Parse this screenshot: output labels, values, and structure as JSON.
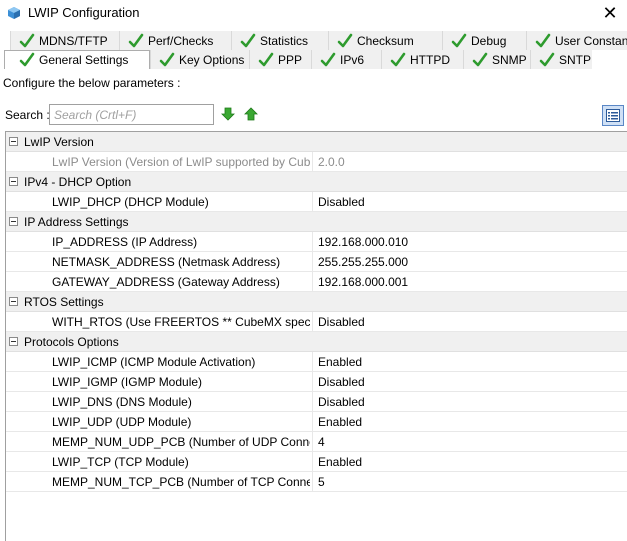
{
  "window": {
    "title": "LWIP Configuration",
    "close_glyph": "✕"
  },
  "tabs": {
    "back_row": [
      {
        "label": "MDNS/TFTP"
      },
      {
        "label": "Perf/Checks"
      },
      {
        "label": "Statistics"
      },
      {
        "label": "Checksum"
      },
      {
        "label": "Debug"
      },
      {
        "label": "User Constants"
      }
    ],
    "front_row": [
      {
        "label": "General Settings",
        "active": true
      },
      {
        "label": "Key Options"
      },
      {
        "label": "PPP"
      },
      {
        "label": "IPv6"
      },
      {
        "label": "HTTPD"
      },
      {
        "label": "SNMP"
      },
      {
        "label": "SNTP"
      }
    ]
  },
  "configure_text": "Configure the below parameters :",
  "search": {
    "label": "Search :",
    "placeholder": "Search (Crtl+F)",
    "value": ""
  },
  "groups": [
    {
      "label": "LwIP Version",
      "params": [
        {
          "name": "LwIP Version (Version of LwIP supported by CubeMX)",
          "value": "2.0.0",
          "disabled": true
        }
      ]
    },
    {
      "label": "IPv4 - DHCP Option",
      "params": [
        {
          "name": "LWIP_DHCP (DHCP Module)",
          "value": "Disabled"
        }
      ]
    },
    {
      "label": "IP Address Settings",
      "params": [
        {
          "name": "IP_ADDRESS (IP Address)",
          "value": "192.168.000.010"
        },
        {
          "name": "NETMASK_ADDRESS (Netmask Address)",
          "value": "255.255.255.000"
        },
        {
          "name": "GATEWAY_ADDRESS (Gateway Address)",
          "value": "192.168.000.001"
        }
      ]
    },
    {
      "label": "RTOS Settings",
      "params": [
        {
          "name": "WITH_RTOS (Use FREERTOS ** CubeMX specific **)",
          "value": "Disabled"
        }
      ]
    },
    {
      "label": "Protocols Options",
      "params": [
        {
          "name": "LWIP_ICMP (ICMP Module Activation)",
          "value": "Enabled"
        },
        {
          "name": "LWIP_IGMP (IGMP Module)",
          "value": "Disabled"
        },
        {
          "name": "LWIP_DNS (DNS Module)",
          "value": "Disabled"
        },
        {
          "name": "LWIP_UDP (UDP Module)",
          "value": "Enabled"
        },
        {
          "name": "MEMP_NUM_UDP_PCB (Number of UDP Connections)",
          "value": "4"
        },
        {
          "name": "LWIP_TCP (TCP Module)",
          "value": "Enabled"
        },
        {
          "name": "MEMP_NUM_TCP_PCB (Number of TCP Connections)",
          "value": "5"
        }
      ]
    }
  ],
  "colors": {
    "check_green": "#2e9b2e",
    "arrow_green": "#3aa832",
    "group_bg": "#f0f0f0"
  }
}
